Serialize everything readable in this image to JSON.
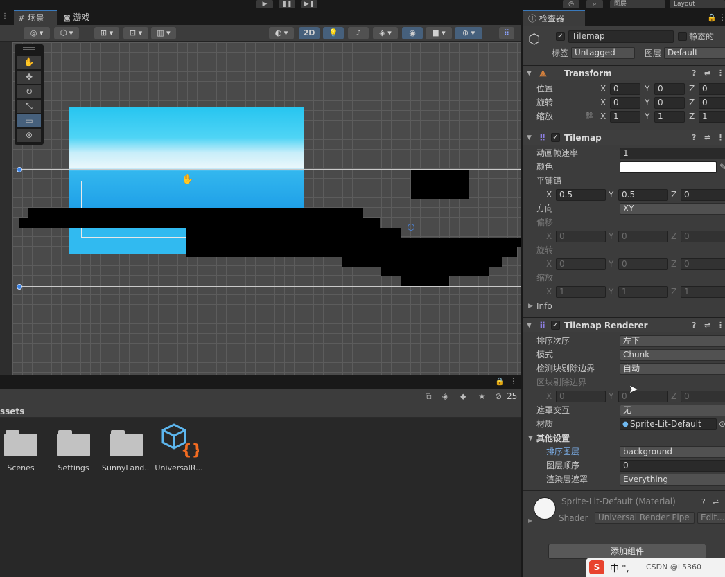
{
  "topbar": {
    "layers_label": "图层",
    "layout_label": "Layout"
  },
  "scene": {
    "tabs": [
      {
        "label": "场景",
        "icon": "grid-icon"
      },
      {
        "label": "游戏",
        "icon": "gamepad-icon"
      }
    ],
    "toolbar": {
      "mode_2d": "2D"
    },
    "tools": [
      "hand-icon",
      "move-icon",
      "rotate-icon",
      "scale-icon",
      "rect-icon",
      "transform-icon"
    ]
  },
  "project": {
    "assets_title": "ssets",
    "hidden_count": "25",
    "assets": [
      {
        "name": "Scenes",
        "type": "folder"
      },
      {
        "name": "Settings",
        "type": "folder"
      },
      {
        "name": "SunnyLand...",
        "type": "folder"
      },
      {
        "name": "UniversalR...",
        "type": "script"
      }
    ]
  },
  "inspector": {
    "tab_label": "检查器",
    "object_name": "Tilemap",
    "static_label": "静态的",
    "tag_label": "标签",
    "tag_value": "Untagged",
    "layer_label": "图层",
    "layer_value": "Default",
    "transform": {
      "title": "Transform",
      "position_label": "位置",
      "position": [
        "0",
        "0",
        "0"
      ],
      "rotation_label": "旋转",
      "rotation": [
        "0",
        "0",
        "0"
      ],
      "scale_label": "缩放",
      "scale": [
        "1",
        "1",
        "1"
      ]
    },
    "tilemap": {
      "title": "Tilemap",
      "anim_rate_label": "动画帧速率",
      "anim_rate": "1",
      "color_label": "颜色",
      "anchor_label": "平铺锚",
      "anchor": [
        "0.5",
        "0.5",
        "0"
      ],
      "orientation_label": "方向",
      "orientation": "XY",
      "offset_label": "偏移",
      "offset": [
        "0",
        "0",
        "0"
      ],
      "rotation_label": "旋转",
      "rotation": [
        "0",
        "0",
        "0"
      ],
      "scale_label": "缩放",
      "scale": [
        "1",
        "1",
        "1"
      ],
      "info_label": "Info"
    },
    "renderer": {
      "title": "Tilemap Renderer",
      "sort_order_label": "排序次序",
      "sort_order": "左下",
      "mode_label": "模式",
      "mode": "Chunk",
      "detect_cull_label": "检测块剔除边界",
      "detect_cull": "自动",
      "chunk_cull_label": "区块剔除边界",
      "chunk_cull": [
        "0",
        "0",
        "0"
      ],
      "mask_label": "遮罩交互",
      "mask": "无",
      "material_label": "材质",
      "material": "Sprite-Lit-Default",
      "other_label": "其他设置",
      "sorting_layer_label": "排序图层",
      "sorting_layer": "background",
      "order_label": "图层顺序",
      "order": "0",
      "render_mask_label": "渲染层遮罩",
      "render_mask": "Everything"
    },
    "material_block": {
      "name": "Sprite-Lit-Default (Material)",
      "shader_label": "Shader",
      "shader": "Universal Render Pipe",
      "edit": "Edit..."
    },
    "add_component": "添加组件"
  },
  "ime": {
    "text": "中 °,",
    "watermark": "CSDN @L5360"
  }
}
